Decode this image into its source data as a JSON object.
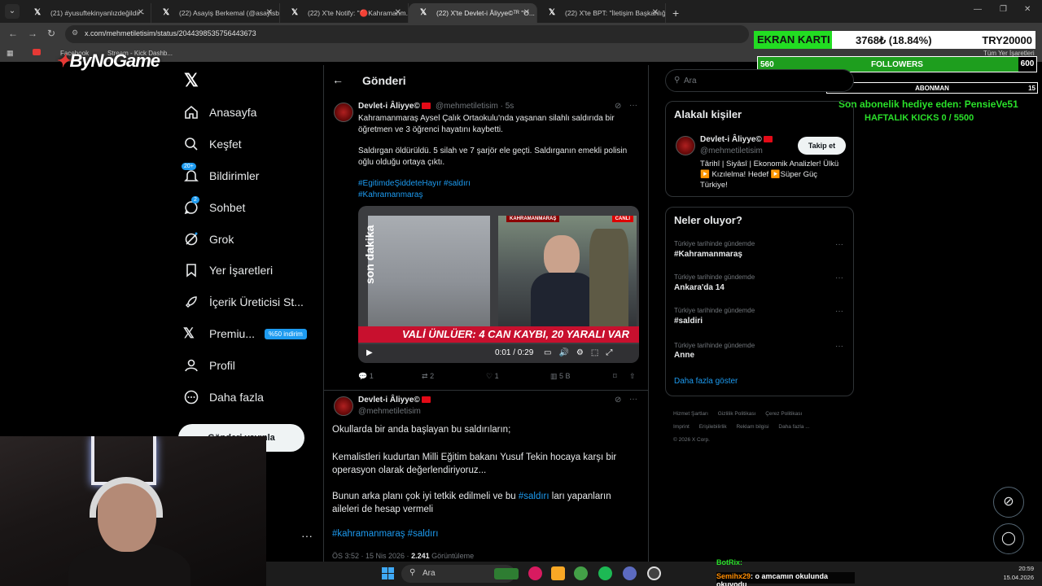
{
  "browser": {
    "tabs": [
      {
        "label": "(21) #yusuftekinyanlızdeğildir -"
      },
      {
        "label": "(22) Asayiş Berkemal (@asayisb..."
      },
      {
        "label": "(22) X'te Notify: \"🔴Kahramanm..."
      },
      {
        "label": "(22) X'te Devlet-i Âliyye©ᵀᴿ \"O...",
        "active": true
      },
      {
        "label": "(22) X'te BPT: \"İletişim Başkanlığ..."
      }
    ],
    "url": "x.com/mehmetiletisim/status/2044398535756443673",
    "bookmarks": [
      "Facebook",
      "Stream - Kick Dashb...",
      "Tüm Yer İşaretleri"
    ]
  },
  "overlay": {
    "brand": "ByNoGame",
    "ekran_label": "EKRAN KARTI",
    "ekran_value": "3768₺ (18.84%)",
    "ekran_goal": "TRY20000",
    "ekran_progress": 0.1884,
    "followers_current": "560",
    "followers_label": "FOLLOWERS",
    "followers_goal": "600",
    "abonman_current": "0",
    "abonman_label": "ABONMAN",
    "abonman_goal": "15",
    "last_sub": "Son abonelik hediye eden: PensieVe51",
    "weekly_kicks": "HAFTALIK KICKS 0 / 5500",
    "chat_user": "Semihx29",
    "chat_message": ": o amcamın okulunda okuyodu",
    "chat_top": "BotRix:"
  },
  "sidebar": {
    "items": [
      {
        "label": "Anasayfa",
        "icon": "home-icon"
      },
      {
        "label": "Keşfet",
        "icon": "search-icon"
      },
      {
        "label": "Bildirimler",
        "icon": "bell-icon",
        "badge": "20+"
      },
      {
        "label": "Sohbet",
        "icon": "chat-icon",
        "badge": "2"
      },
      {
        "label": "Grok",
        "icon": "grok-icon"
      },
      {
        "label": "Yer İşaretleri",
        "icon": "bookmark-icon"
      },
      {
        "label": "İçerik Üreticisi St...",
        "icon": "rocket-icon"
      },
      {
        "label": "Premiu...",
        "icon": "x-icon",
        "promo": "%50 indirim"
      },
      {
        "label": "Profil",
        "icon": "person-icon"
      },
      {
        "label": "Daha fazla",
        "icon": "more-circle-icon"
      }
    ],
    "post_button": "Gönderi yayınla"
  },
  "main": {
    "title": "Gönderi",
    "tweet1": {
      "name": "Devlet-i Âliyye©",
      "handle": "@mehmetiletisim · 5s",
      "p1": "Kahramanmaraş Aysel Çalık Ortaokulu'nda yaşanan silahlı saldırıda bir öğretmen ve 3 öğrenci hayatını kaybetti.",
      "p2": "Saldırgan öldürüldü. 5 silah ve 7 şarjör ele geçti. Saldırganın emekli polisin oğlu olduğu ortaya çıktı.",
      "tags1": "#EgitimdeŞiddeteHayır #saldırı",
      "tags2": "#Kahramanmaraş",
      "video": {
        "banner": "VALİ ÜNLÜER: 4 CAN KAYBI, 20 YARALI VAR",
        "side_text": "son dakika",
        "time": "0:01 / 0:29",
        "channel_tag": "CANLI",
        "location_tag": "KAHRAMANMARAŞ"
      },
      "replies": "1",
      "reposts": "2",
      "likes": "1",
      "views": "5 B"
    },
    "tweet2": {
      "name": "Devlet-i Âliyye©",
      "handle": "@mehmetiletisim",
      "p1": "Okullarda bir anda başlayan bu saldırıların;",
      "p2": "Kemalistleri kudurtan Milli Eğitim bakanı Yusuf Tekin hocaya karşı bir operasyon olarak değerlendiriyoruz...",
      "p3a": "Bunun arka planı çok iyi tetkik edilmeli ve bu ",
      "p3tag": "#saldırı",
      "p3b": " ları yapanların aileleri de hesap vermeli",
      "tags": "#kahramanmaraş #saldırı",
      "meta_time": "ÖS 3:52 · 15 Nis 2026 · ",
      "meta_views": "2.241",
      "meta_views_label": " Görüntüleme"
    }
  },
  "right": {
    "search_placeholder": "Ara",
    "related_title": "Alakalı kişiler",
    "related_name": "Devlet-i Âliyye©",
    "related_handle": "@mehmetiletisim",
    "follow_label": "Takip et",
    "bio": "Târihî | Siyâsî | Ekonomik Analizler! Ülkü ▶️ Kızılelma! Hedef ▶️Süper Güç Türkiye!",
    "trends_title": "Neler oluyor?",
    "trends": [
      {
        "category": "Türkiye tarihinde gündemde",
        "name": "#Kahramanmaraş"
      },
      {
        "category": "Türkiye tarihinde gündemde",
        "name": "Ankara'da 14"
      },
      {
        "category": "Türkiye tarihinde gündemde",
        "name": "#saldiri"
      },
      {
        "category": "Türkiye tarihinde gündemde",
        "name": "Anne"
      }
    ],
    "show_more": "Daha fazla göster",
    "footer": [
      "Hizmet Şartları",
      "Gizlilik Politikası",
      "Çerez Politikası",
      "Imprint",
      "Erişilebilirlik",
      "Reklam bilgisi",
      "Daha fazla ...",
      "© 2026 X Corp."
    ]
  },
  "taskbar": {
    "search_placeholder": "Ara",
    "time": "20:59",
    "date": "15.04.2026"
  },
  "colors": {
    "accent": "#1d9bf0",
    "background": "#000000",
    "overlay_green": "#22dd22",
    "news_red": "#c8102e"
  }
}
